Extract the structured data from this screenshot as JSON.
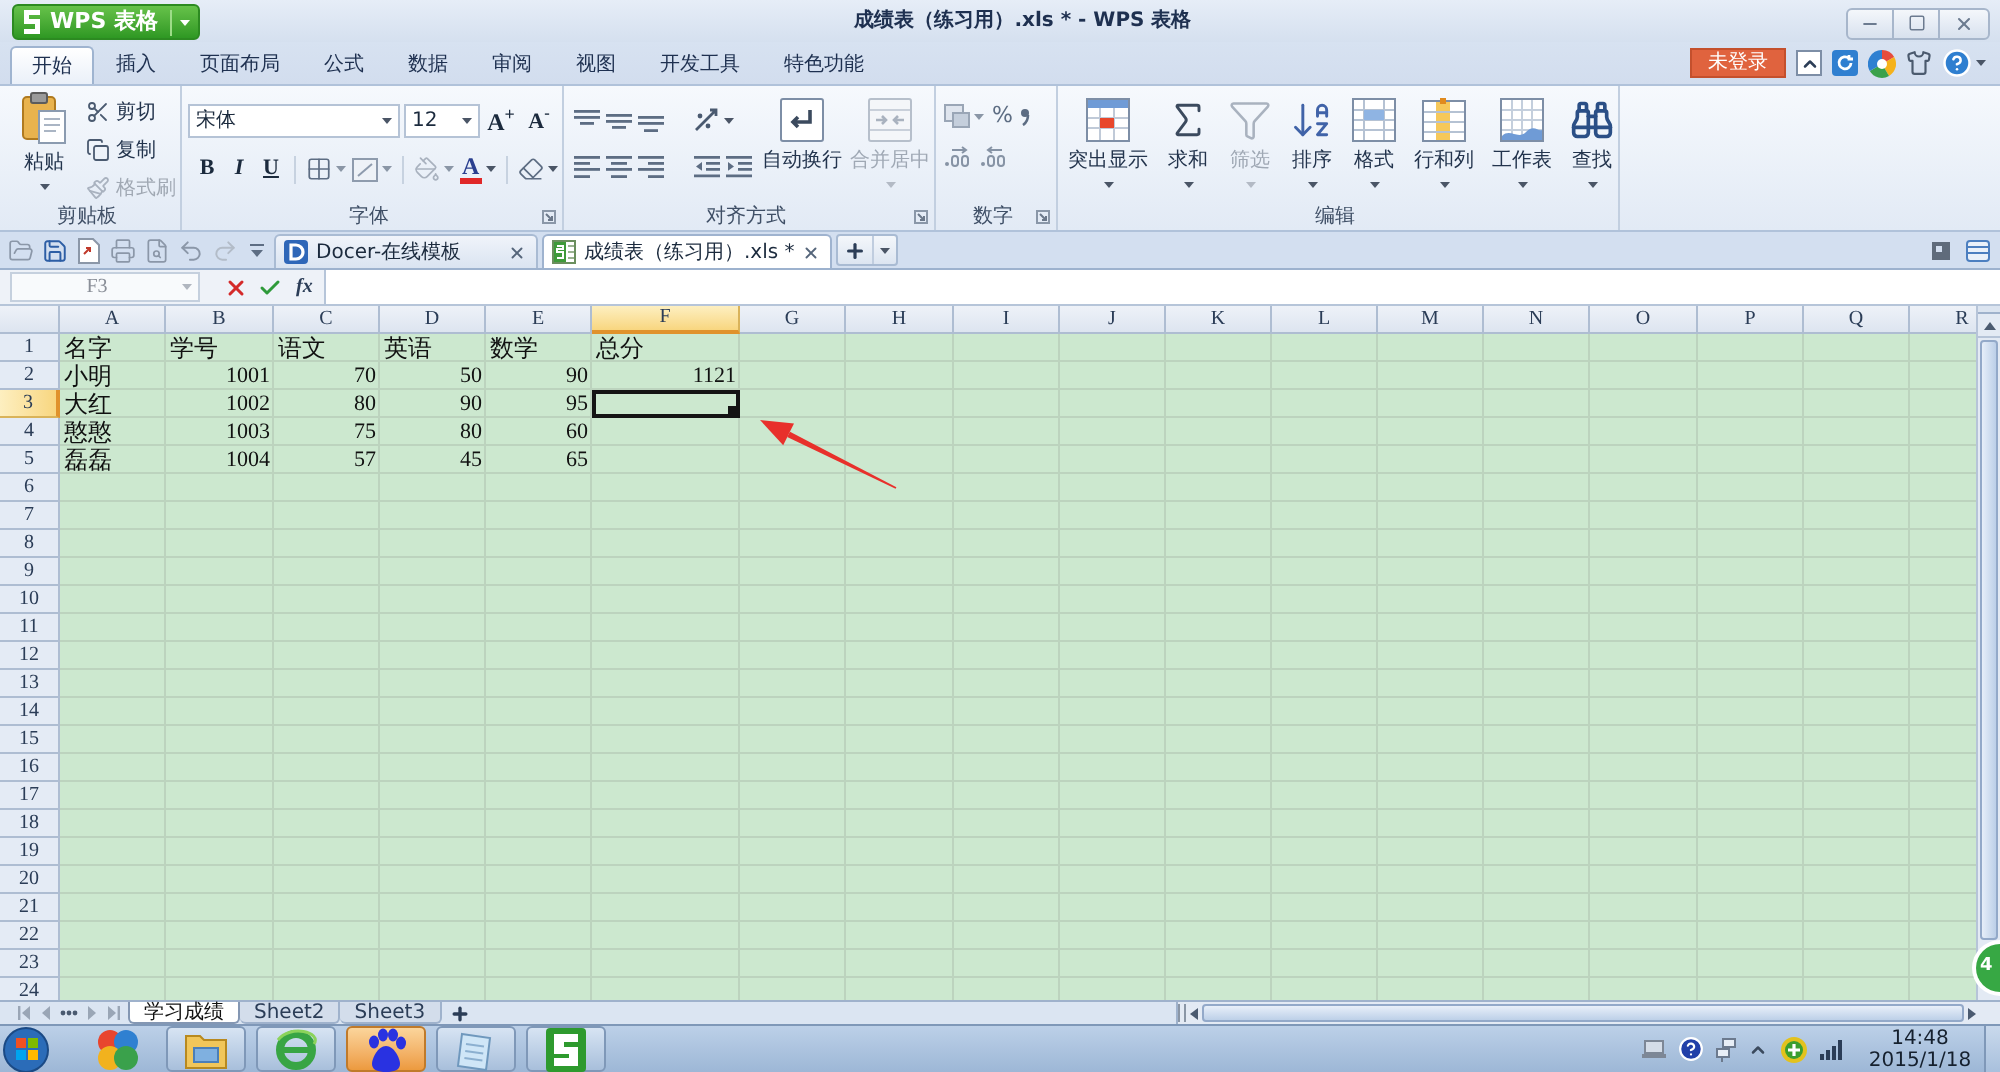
{
  "window": {
    "title": "成绩表（练习用）.xls * - WPS 表格",
    "app_name": "WPS 表格"
  },
  "ribbon_tabs": [
    {
      "label": "开始",
      "selected": true
    },
    {
      "label": "插入",
      "selected": false
    },
    {
      "label": "页面布局",
      "selected": false
    },
    {
      "label": "公式",
      "selected": false
    },
    {
      "label": "数据",
      "selected": false
    },
    {
      "label": "审阅",
      "selected": false
    },
    {
      "label": "视图",
      "selected": false
    },
    {
      "label": "开发工具",
      "selected": false
    },
    {
      "label": "特色功能",
      "selected": false
    }
  ],
  "account": {
    "login": "未登录"
  },
  "clipboard": {
    "title": "剪贴板",
    "paste": "粘贴",
    "tools": [
      {
        "kind": "cut",
        "label": "剪切",
        "disabled": false
      },
      {
        "kind": "copy",
        "label": "复制",
        "disabled": false
      },
      {
        "kind": "painter",
        "label": "格式刷",
        "disabled": true
      }
    ]
  },
  "font": {
    "title": "字体",
    "font_name": "宋体",
    "font_size": "12",
    "grow": "A$^{+}$",
    "shrink": "A$^{-}$",
    "styles": [
      {
        "kind": "bold",
        "label": "B"
      },
      {
        "kind": "italic",
        "label": "I"
      },
      {
        "kind": "underline",
        "label": "U"
      }
    ],
    "color_button": "A"
  },
  "alignment": {
    "title": "对齐方式",
    "buttons": [
      {
        "kind": "wrap",
        "label": "自动换行",
        "disabled": false
      },
      {
        "kind": "merge",
        "label": "合并居中",
        "disabled": true
      }
    ]
  },
  "number": {
    "title": "数字",
    "percent": "%"
  },
  "editing": {
    "title": "编辑",
    "buttons": [
      {
        "kind": "highlight",
        "label": "突出显示",
        "disabled": false
      },
      {
        "kind": "sum",
        "label": "求和",
        "disabled": false
      },
      {
        "kind": "filter",
        "label": "筛选",
        "disabled": true
      },
      {
        "kind": "sort",
        "label": "排序",
        "disabled": false
      },
      {
        "kind": "format",
        "label": "格式",
        "disabled": false
      },
      {
        "kind": "rows_columns",
        "label": "行和列",
        "disabled": false
      },
      {
        "kind": "worksheet",
        "label": "工作表",
        "disabled": false
      },
      {
        "kind": "find",
        "label": "查找",
        "disabled": false
      }
    ]
  },
  "doc_tabs": [
    {
      "kind": "docer",
      "label": "Docer-在线模板",
      "selected": false
    },
    {
      "kind": "spreadsheet",
      "label": "成绩表（练习用）.xls *",
      "selected": true
    }
  ],
  "formula_bar": {
    "name_box": "F3",
    "function_label": "fx"
  },
  "sheet": {
    "columns": [
      {
        "label": "A",
        "selected": false
      },
      {
        "label": "B",
        "selected": false
      },
      {
        "label": "C",
        "selected": false
      },
      {
        "label": "D",
        "selected": false
      },
      {
        "label": "E",
        "selected": false
      },
      {
        "label": "F",
        "selected": true
      },
      {
        "label": "G",
        "selected": false
      },
      {
        "label": "H",
        "selected": false
      },
      {
        "label": "I",
        "selected": false
      },
      {
        "label": "J",
        "selected": false
      },
      {
        "label": "K",
        "selected": false
      },
      {
        "label": "L",
        "selected": false
      },
      {
        "label": "M",
        "selected": false
      },
      {
        "label": "N",
        "selected": false
      },
      {
        "label": "O",
        "selected": false
      },
      {
        "label": "P",
        "selected": false
      },
      {
        "label": "Q",
        "selected": false
      },
      {
        "label": "R",
        "selected": false
      }
    ],
    "rows": [
      {
        "number": "1",
        "selected": false,
        "cells": [
          {
            "text": "名字",
            "kind": "text",
            "selected": false
          },
          {
            "text": "学号",
            "kind": "text",
            "selected": false
          },
          {
            "text": "语文",
            "kind": "text",
            "selected": false
          },
          {
            "text": "英语",
            "kind": "text",
            "selected": false
          },
          {
            "text": "数学",
            "kind": "text",
            "selected": false
          },
          {
            "text": "总分",
            "kind": "text",
            "selected": false
          }
        ]
      },
      {
        "number": "2",
        "selected": false,
        "cells": [
          {
            "text": "小明",
            "kind": "text",
            "selected": false
          },
          {
            "text": "1001",
            "kind": "number",
            "selected": false
          },
          {
            "text": "70",
            "kind": "number",
            "selected": false
          },
          {
            "text": "50",
            "kind": "number",
            "selected": false
          },
          {
            "text": "90",
            "kind": "number",
            "selected": false
          },
          {
            "text": "1121",
            "kind": "number",
            "selected": false
          }
        ]
      },
      {
        "number": "3",
        "selected": true,
        "cells": [
          {
            "text": "大红",
            "kind": "text",
            "selected": false
          },
          {
            "text": "1002",
            "kind": "number",
            "selected": false
          },
          {
            "text": "80",
            "kind": "number",
            "selected": false
          },
          {
            "text": "90",
            "kind": "number",
            "selected": false
          },
          {
            "text": "95",
            "kind": "number",
            "selected": false
          },
          {
            "kind": "number",
            "selected": true
          }
        ]
      },
      {
        "number": "4",
        "selected": false,
        "cells": [
          {
            "text": "憨憨",
            "kind": "text",
            "selected": false
          },
          {
            "text": "1003",
            "kind": "number",
            "selected": false
          },
          {
            "text": "75",
            "kind": "number",
            "selected": false
          },
          {
            "text": "80",
            "kind": "number",
            "selected": false
          },
          {
            "text": "60",
            "kind": "number",
            "selected": false
          }
        ]
      },
      {
        "number": "5",
        "selected": false,
        "cells": [
          {
            "text": "磊磊",
            "kind": "text",
            "selected": false
          },
          {
            "text": "1004",
            "kind": "number",
            "selected": false
          },
          {
            "text": "57",
            "kind": "number",
            "selected": false
          },
          {
            "text": "45",
            "kind": "number",
            "selected": false
          },
          {
            "text": "65",
            "kind": "number",
            "selected": false
          }
        ]
      },
      {
        "number": "6",
        "selected": false
      },
      {
        "number": "7",
        "selected": false
      },
      {
        "number": "8",
        "selected": false
      },
      {
        "number": "9",
        "selected": false
      },
      {
        "number": "10",
        "selected": false
      },
      {
        "number": "11",
        "selected": false
      },
      {
        "number": "12",
        "selected": false
      },
      {
        "number": "13",
        "selected": false
      },
      {
        "number": "14",
        "selected": false
      },
      {
        "number": "15",
        "selected": false
      },
      {
        "number": "16",
        "selected": false
      },
      {
        "number": "17",
        "selected": false
      },
      {
        "number": "18",
        "selected": false
      },
      {
        "number": "19",
        "selected": false
      },
      {
        "number": "20",
        "selected": false
      },
      {
        "number": "21",
        "selected": false
      },
      {
        "number": "22",
        "selected": false
      },
      {
        "number": "23",
        "selected": false
      },
      {
        "number": "24",
        "selected": false
      }
    ]
  },
  "sheet_tabs": [
    {
      "label": "学习成绩",
      "selected": true
    },
    {
      "label": "Sheet2",
      "selected": false
    },
    {
      "label": "Sheet3",
      "selected": false
    }
  ],
  "taskbar": {
    "apps": [
      {
        "kind": "pinwheel",
        "running": false,
        "active": false
      },
      {
        "kind": "explorer",
        "running": true,
        "active": false
      },
      {
        "kind": "ie",
        "running": true,
        "active": false
      },
      {
        "kind": "baidu",
        "running": true,
        "active": true
      },
      {
        "kind": "notepad",
        "running": true,
        "active": false
      },
      {
        "kind": "wps",
        "running": true,
        "active": false
      }
    ],
    "clock": {
      "time": "14:48",
      "date": "2015/1/18"
    }
  },
  "floating_badge": {
    "text": "4"
  }
}
